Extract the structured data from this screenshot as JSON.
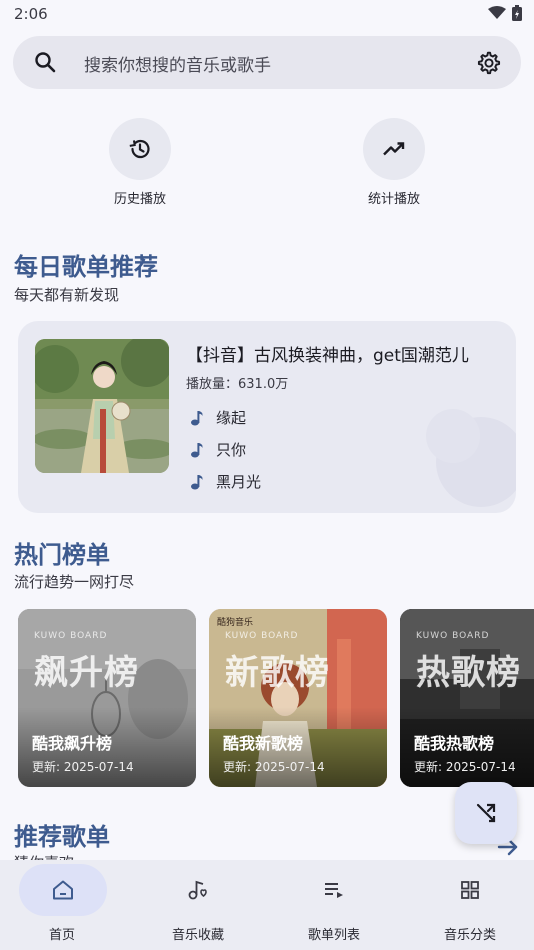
{
  "status": {
    "time": "2:06"
  },
  "search": {
    "placeholder": "搜索你想搜的音乐或歌手"
  },
  "quick_actions": [
    {
      "label": "历史播放",
      "icon": "history-icon"
    },
    {
      "label": "统计播放",
      "icon": "trending-up-icon"
    }
  ],
  "daily": {
    "title": "每日歌单推荐",
    "subtitle": "每天都有新发现",
    "card": {
      "title": "【抖音】古风换装神曲，get国潮范儿",
      "plays_label": "播放量：",
      "plays_value": "631.0万",
      "songs": [
        "缘起",
        "只你",
        "黑月光"
      ]
    }
  },
  "hot": {
    "title": "热门榜单",
    "subtitle": "流行趋势一网打尽",
    "boards": [
      {
        "board": "KUWO BOARD",
        "big": "飙升榜",
        "name": "酷我飙升榜",
        "update_label": "更新:",
        "date": "2025-07-14"
      },
      {
        "board": "KUWO BOARD",
        "big": "新歌榜",
        "name": "酷我新歌榜",
        "update_label": "更新:",
        "date": "2025-07-14",
        "tag": "酷狗音乐"
      },
      {
        "board": "KUWO BOARD",
        "big": "热歌榜",
        "name": "酷我热歌榜",
        "update_label": "更新:",
        "date": "2025-07-14"
      }
    ]
  },
  "recommend": {
    "title": "推荐歌单",
    "subtitle": "猜你喜欢"
  },
  "nav": [
    {
      "label": "首页",
      "icon": "home-icon",
      "active": true
    },
    {
      "label": "音乐收藏",
      "icon": "music-favorite-icon"
    },
    {
      "label": "歌单列表",
      "icon": "playlist-icon"
    },
    {
      "label": "音乐分类",
      "icon": "category-grid-icon"
    }
  ],
  "colors": {
    "accent": "#3e5b8f",
    "background": "#f7f7fc",
    "nav_active": "#dde1f7"
  }
}
